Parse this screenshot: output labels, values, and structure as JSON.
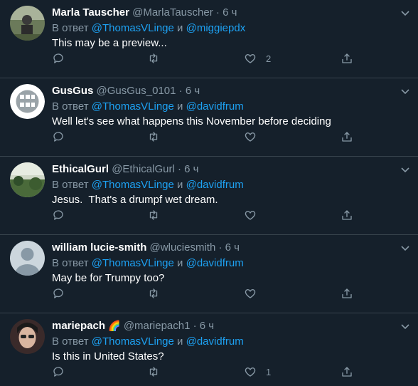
{
  "common": {
    "reply_prefix": "В ответ",
    "and": "и",
    "dot": "·"
  },
  "tweets": [
    {
      "name": "Marla Tauscher",
      "handle": "@MarlaTauscher",
      "time": "6 ч",
      "mention1": "@ThomasVLinge",
      "mention2": "@miggiepdx",
      "text": "This may be a preview...",
      "like_count": "2",
      "avatar": "photo-person-outdoors"
    },
    {
      "name": "GusGus",
      "handle": "@GusGus_0101",
      "time": "6 ч",
      "mention1": "@ThomasVLinge",
      "mention2": "@davidfrum",
      "text": "Well let's see what happens this November before deciding",
      "avatar": "gusgus-logo"
    },
    {
      "name": "EthicalGurl",
      "handle": "@EthicalGurl",
      "time": "6 ч",
      "mention1": "@ThomasVLinge",
      "mention2": "@davidfrum",
      "text": "Jesus.  That's a drumpf wet dream.",
      "avatar": "photo-landscape"
    },
    {
      "name": "william lucie-smith",
      "handle": "@wluciesmith",
      "time": "6 ч",
      "mention1": "@ThomasVLinge",
      "mention2": "@davidfrum",
      "text": "May be for Trumpy too?",
      "avatar": "default-avatar"
    },
    {
      "name": "mariepach",
      "name_emoji": "🌈",
      "handle": "@mariepach1",
      "time": "6 ч",
      "mention1": "@ThomasVLinge",
      "mention2": "@davidfrum",
      "text": "Is this in United States?",
      "like_count": "1",
      "avatar": "photo-selfie"
    }
  ],
  "colors": {
    "background": "#15202b",
    "muted": "#8899a6",
    "link": "#1da1f2",
    "divider": "#38444d"
  }
}
